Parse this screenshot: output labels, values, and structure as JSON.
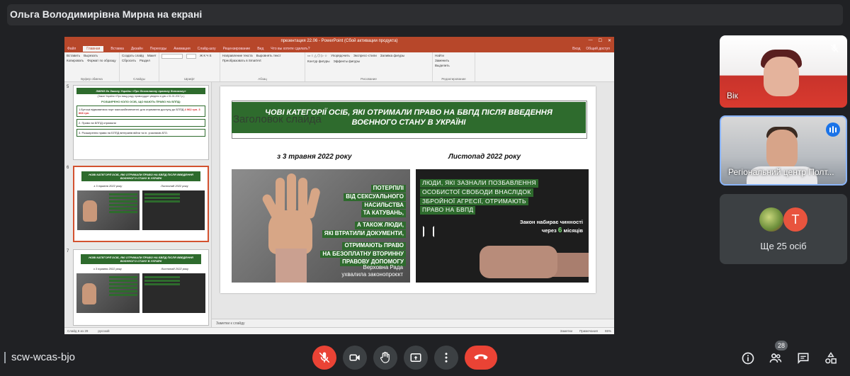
{
  "banner": {
    "presenter": "Ольга Володимирівна Мирна на екрані"
  },
  "powerpoint": {
    "window_title": "презентация 22.06 - PowerPoint (Сбой активации продукта)",
    "menu": [
      "Файл",
      "Главная",
      "Вставка",
      "Дизайн",
      "Переходы",
      "Анимация",
      "Слайд-шоу",
      "Рецензирование",
      "Вид",
      "Что вы хотите сделать?"
    ],
    "menu_right": [
      "Вход",
      "Общий доступ"
    ],
    "ribbon": {
      "clipboard": {
        "items": [
          "Вставить",
          "Вырезать",
          "Копировать",
          "Формат по образцу"
        ],
        "label": "Буфер обмена"
      },
      "slides": {
        "items": [
          "Создать слайд",
          "Макет",
          "Сбросить",
          "Раздел"
        ],
        "label": "Слайды"
      },
      "font": {
        "label": "Шрифт"
      },
      "paragraph": {
        "items": [
          "Направление текста",
          "Выровнять текст",
          "Преобразовать в SmartArt"
        ],
        "label": "Абзац"
      },
      "drawing": {
        "items": [
          "Упорядочить",
          "Экспресс-стили",
          "Заливка фигуры",
          "Контур фигуры",
          "Эффекты фигуры"
        ],
        "label": "Рисование"
      },
      "editing": {
        "items": [
          "Найти",
          "Заменить",
          "Выделить"
        ],
        "label": "Редактирование"
      }
    },
    "thumbnails": [
      {
        "number": "5",
        "title": "ЗМІНИ до Закону України «Про безоплатну правову допомогу»",
        "subtitle": "(Закон України «Про вищу раду правосуддя» уведено в дію з 01.01.2017 р.)",
        "heading": "РОЗШИРЕНО КОЛО ОСІБ, ЩО МАЮТЬ ПРАВО НА БППД:",
        "item1": "1.Бутські відмовитися порт малозабезпеченні: для отримання доступу до БППД",
        "amount1": "4 962 грн.",
        "amount2": "3 868 грн.",
        "item2": "2. Право на БППД отримали",
        "item3": "3. Розширення права на БППД ветеранів війни та ін. учасників АТО."
      },
      {
        "number": "6",
        "title": "НОВІ КАТЕГОРІЇ ОСІБ, ЯКІ ОТРИМАЛИ ПРАВО НА БВПД ПІСЛЯ ВВЕДЕННЯ ВОЄННОГО СТАНУ В УКРАЇНІ",
        "col_left": "з 3 травня 2022 року",
        "col_right": "Листопад 2022 року"
      },
      {
        "number": "7",
        "title": "НОВІ КАТЕГОРІЇ ОСІБ, ЯКІ ОТРИМАЛИ ПРАВО НА БВПД ПІСЛЯ ВВЕДЕННЯ ВОЄННОГО СТАНУ В УКРАЇНІ",
        "col_left": "з 3 травня 2022 року",
        "col_right": "Листопад 2022 року"
      }
    ],
    "slide": {
      "header": "ЧОВІ КАТЕГОРІЇ ОСІБ, ЯКІ ОТРИМАЛИ ПРАВО НА БВПД ПІСЛЯ ВВЕДЕННЯ ВОЄННОГО СТАНУ В УКРАЇНІ",
      "placeholder": "Заголовок слайда",
      "col_left": "з 3 травня 2022 року",
      "col_right": "Листопад 2022 року",
      "left_lines": [
        "ПОТЕРПІЛІ",
        "ВІД СЕКСУАЛЬНОГО",
        "НАСИЛЬСТВА",
        "ТА КАТУВАНЬ,",
        "А ТАКОЖ ЛЮДИ,",
        "ЯКІ ВТРАТИЛИ ДОКУМЕНТИ,",
        "ОТРИМАЮТЬ ПРАВО",
        "НА БЕЗОПЛАТНУ ВТОРИННУ",
        "ПРАВОВУ ДОПОМОГУ"
      ],
      "left_sign": [
        "Верховна Рада",
        "ухвалила законопроєкт"
      ],
      "right_lines": [
        "ЛЮДИ, ЯКІ ЗАЗНАЛИ ПОЗБАВЛЕННЯ",
        "ОСОБИСТОЇ СВОБОДИ ВНАСЛІДОК",
        "ЗБРОЙНОЇ АГРЕСІЇ, ОТРИМАЮТЬ",
        "ПРАВО НА БВПД"
      ],
      "law_line1": "Закон набирає чинності",
      "law_prefix": "через",
      "law_number": "6",
      "law_suffix": "місяців"
    },
    "notes": "Заметки к слайду",
    "status": {
      "slide_info": "Слайд 6 из 29",
      "language": "русский",
      "notes_btn": "Заметки",
      "comments_btn": "Примечания",
      "zoom": "65%"
    }
  },
  "participants": [
    {
      "label": "Вік",
      "muted": true
    },
    {
      "label": "Регіональний центр Полт...",
      "speaking": true
    },
    {
      "more_label": "Ще 25 осіб",
      "avatar_letter": "T"
    }
  ],
  "bottom": {
    "meeting_code": "scw-wcas-bjo",
    "participant_count": "28"
  },
  "colors": {
    "accent": "#1a73e8",
    "danger": "#ea4335",
    "slide_green": "#2e6b2d",
    "ppt_red": "#b7472a"
  }
}
